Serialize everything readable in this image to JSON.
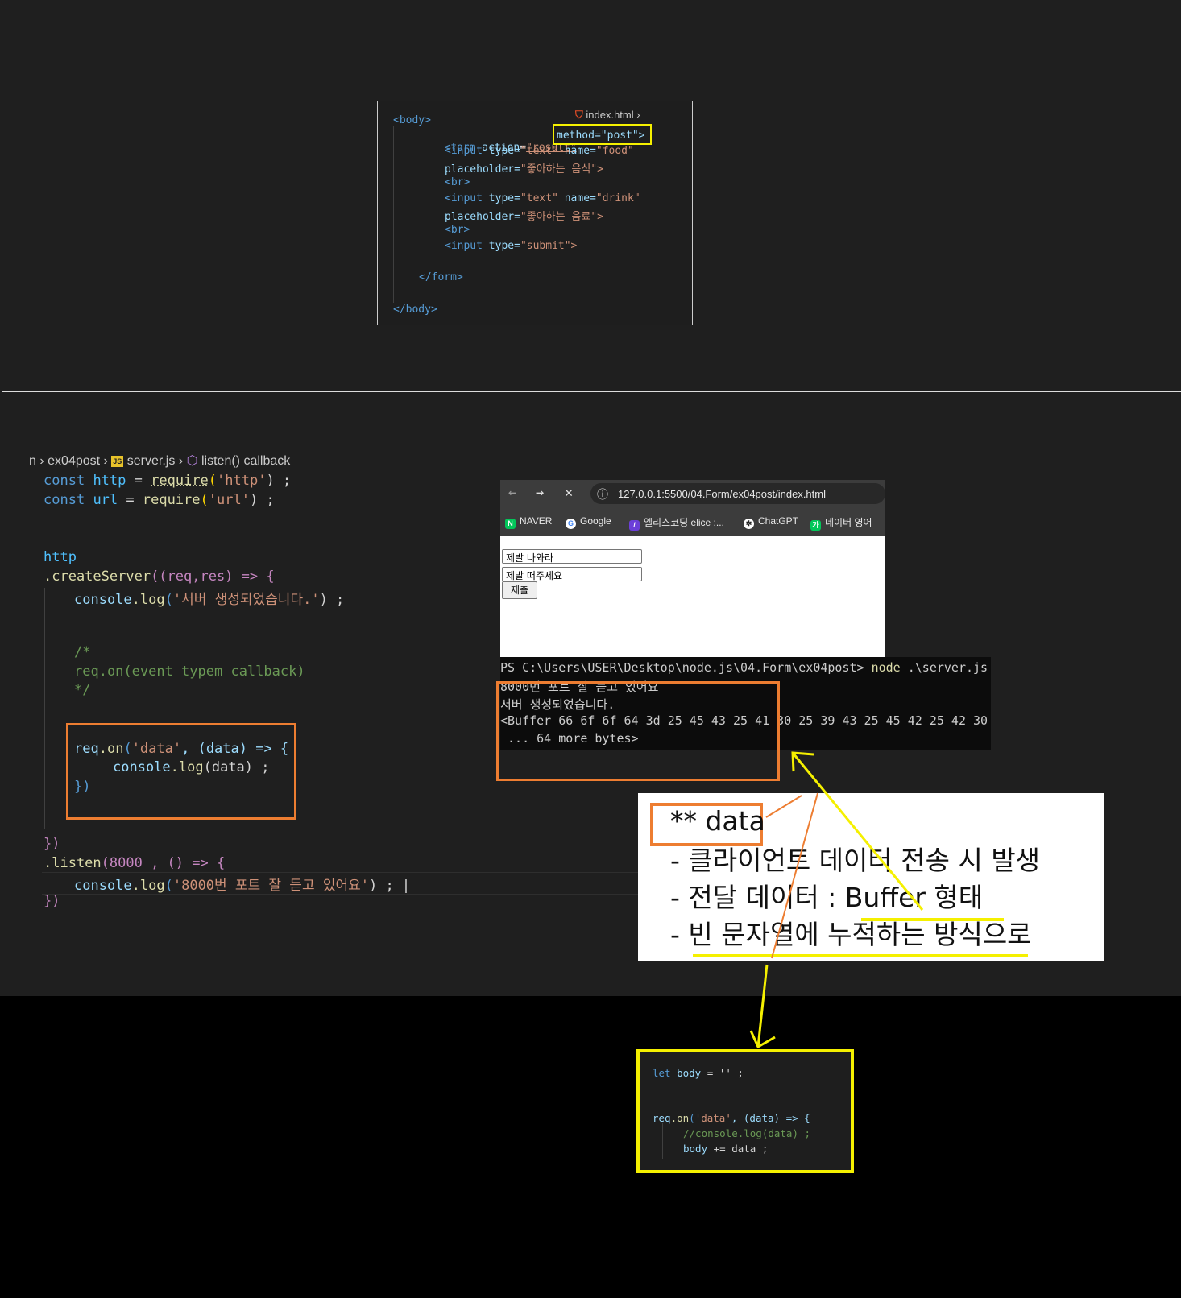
{
  "top_panel": {
    "breadcrumb_file": "index.html",
    "lines": {
      "body_open": "<body>",
      "form_open_pre": "<form ",
      "form_action_attr": "action",
      "form_action_val": "\"result\"",
      "form_method": "method=\"post\">",
      "input1_pre": "<input ",
      "input1_type": "type=",
      "input1_type_val": "\"text\"",
      "input1_name": "name=",
      "input1_name_val": "\"food\"",
      "placeholder1_attr": "placeholder=",
      "placeholder1_val": "\"좋아하는 음식\">",
      "br1": "<br>",
      "input2_pre": "<input ",
      "input2_type": "type=",
      "input2_type_val": "\"text\"",
      "input2_name": "name=",
      "input2_name_val": "\"drink\"",
      "placeholder2_attr": "placeholder=",
      "placeholder2_val": "\"좋아하는 음료\">",
      "br2": "<br>",
      "input3_pre": "<input ",
      "input3_type": "type=",
      "input3_type_val": "\"submit\">",
      "form_close": "</form>",
      "body_close": "</body>"
    }
  },
  "editor": {
    "breadcrumb": {
      "part0": "n",
      "folder": "ex04post",
      "file": "server.js",
      "symbol": "listen() callback"
    },
    "code": {
      "l1_kw": "const",
      "l1_var": "http",
      "l1_eq": " = ",
      "l1_fn": "require",
      "l1_str": "'http'",
      "l1_end": ") ;",
      "l2_kw": "const",
      "l2_var": "url",
      "l2_eq": " = ",
      "l2_fn": "require",
      "l2_str": "'url'",
      "l2_end": ") ;",
      "l3": "http",
      "l4_fn": ".createServer",
      "l4_args": "((req,res) => {",
      "l5_obj": "console",
      "l5_fn": ".log",
      "l5_str": "'서버 생성되었습니다.'",
      "l5_end": ") ;",
      "c1": "/*",
      "c2": "req.on(event typem callback)",
      "c3": "*/",
      "r1_obj": "req",
      "r1_fn": ".on",
      "r1_str": "'data'",
      "r1_rest": ", (data) => {",
      "r2_obj": "console",
      "r2_fn": ".log",
      "r2_arg": "(data) ;",
      "r3": "})",
      "close1": "})",
      "listen_fn": ".listen",
      "listen_args": "(8000 , () => {",
      "listen_log_obj": "console",
      "listen_log_fn": ".log",
      "listen_log_str": "'8000번 포트 잘 듣고 있어요'",
      "listen_log_end": ") ;",
      "close2": "})"
    }
  },
  "browser": {
    "url": "127.0.0.1:5500/04.Form/ex04post/index.html",
    "bookmarks": [
      "NAVER",
      "Google",
      "엘리스코딩 elice :...",
      "ChatGPT",
      "네이버 영어"
    ],
    "input_food_value": "제발 나와라",
    "input_drink_value": "제발 떠주세요",
    "submit_label": "제출"
  },
  "terminal": {
    "prompt": "PS C:\\Users\\USER\\Desktop\\node.js\\04.Form\\ex04post>",
    "cmd": "node",
    "cmd_arg": ".\\server.js",
    "out1": "8000번 포트 잘 듣고 있어요",
    "out2": "서버 생성되었습니다.",
    "out3": "<Buffer 66 6f 6f 64 3d 25 45 43 25 41 30 25 39 43 25 45 42 25 42 30",
    "out4": " ... 64 more bytes>"
  },
  "note": {
    "title": "** data",
    "line1": "- 클라이언트 데이터 전송 시 발생",
    "line2": "- 전달 데이터 : Buffer 형태",
    "line3": "- 빈 문자열에 누적하는 방식으로"
  },
  "bottom_code": {
    "l1_kw": "let",
    "l1_var": "body",
    "l1_rest": " = '' ;",
    "l2_obj": "req",
    "l2_fn": ".on",
    "l2_str": "'data'",
    "l2_rest": ", (data) => {",
    "l3": "//console.log(data) ;",
    "l4_var": "body",
    "l4_rest": " += data ;"
  },
  "colors": {
    "highlight_yellow": "#f5f000",
    "highlight_orange": "#ed7d31",
    "editor_bg": "#1f1f1f",
    "terminal_bg": "#0c0c0c"
  }
}
